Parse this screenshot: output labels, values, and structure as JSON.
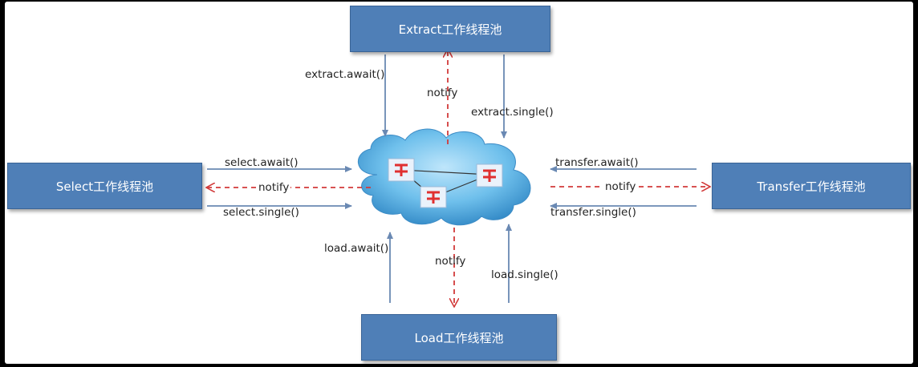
{
  "pools": {
    "extract": "Extract工作线程池",
    "select": "Select工作线程池",
    "transfer": "Transfer工作线程池",
    "load": "Load工作线程池"
  },
  "labels": {
    "extract_await": "extract.await()",
    "extract_single": "extract.single()",
    "extract_notify": "notify",
    "select_await": "select.await()",
    "select_single": "select.single()",
    "select_notify": "notify",
    "transfer_await": "transfer.await()",
    "transfer_single": "transfer.single()",
    "transfer_notify": "notify",
    "load_await": "load.await()",
    "load_single": "load.single()",
    "load_notify": "notify"
  },
  "colors": {
    "box_fill": "#4f7fb7",
    "solid_arrow": "#6a89b3",
    "notify_arrow": "#d23a3a",
    "cloud": "#5fb2e6"
  },
  "icons": [
    "cloud-icon",
    "router-icon"
  ]
}
